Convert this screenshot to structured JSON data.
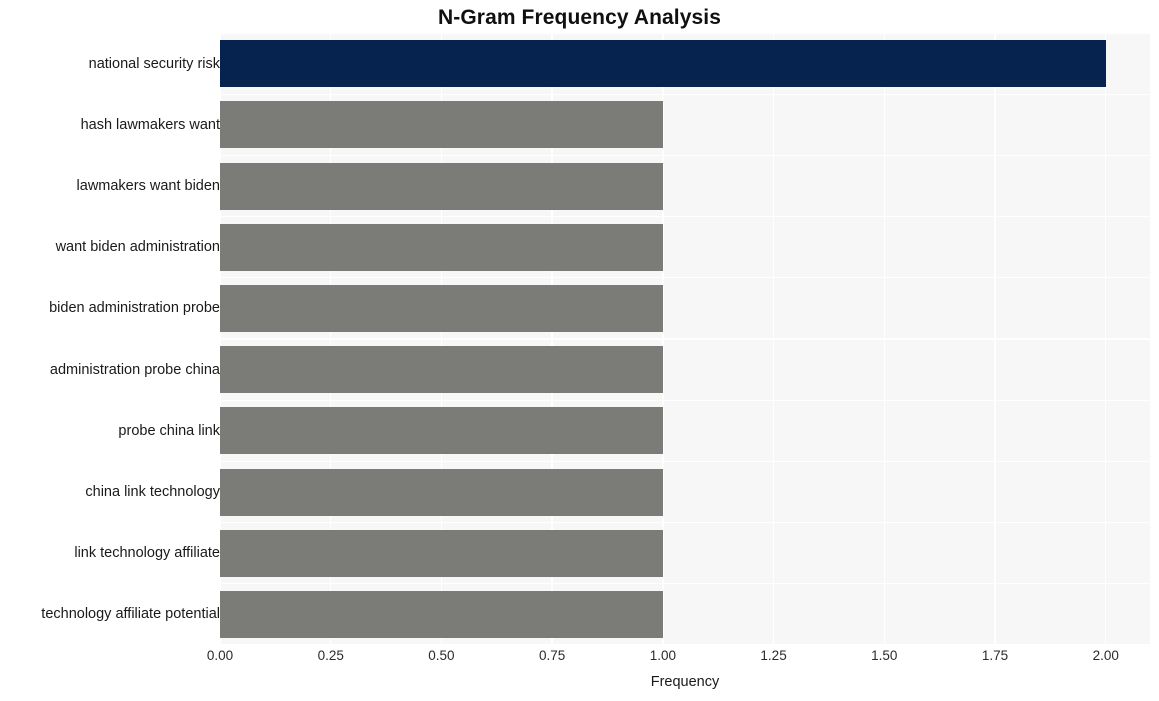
{
  "chart_data": {
    "type": "bar",
    "orientation": "horizontal",
    "title": "N-Gram Frequency Analysis",
    "xlabel": "Frequency",
    "ylabel": "",
    "categories": [
      "national security risk",
      "hash lawmakers want",
      "lawmakers want biden",
      "want biden administration",
      "biden administration probe",
      "administration probe china",
      "probe china link",
      "china link technology",
      "link technology affiliate",
      "technology affiliate potential"
    ],
    "values": [
      2,
      1,
      1,
      1,
      1,
      1,
      1,
      1,
      1,
      1
    ],
    "xlim": [
      0,
      2.1
    ],
    "xticks": [
      0,
      0.25,
      0.5,
      0.75,
      1,
      1.25,
      1.5,
      1.75,
      2
    ],
    "xtick_labels": [
      "0.00",
      "0.25",
      "0.50",
      "0.75",
      "1.00",
      "1.25",
      "1.50",
      "1.75",
      "2.00"
    ],
    "bar_colors": [
      "#06234f",
      "#7b7b78",
      "#7b7b78",
      "#7b7b78",
      "#7b7b78",
      "#7b7b78",
      "#7b7b78",
      "#7b7b78",
      "#7b7b78",
      "#7b7b78"
    ],
    "highlight_color": "#06234f",
    "default_color": "#7b7b78",
    "plot_background": "#f7f7f7",
    "grid": true,
    "grid_color": "#ffffff",
    "legend": null
  }
}
